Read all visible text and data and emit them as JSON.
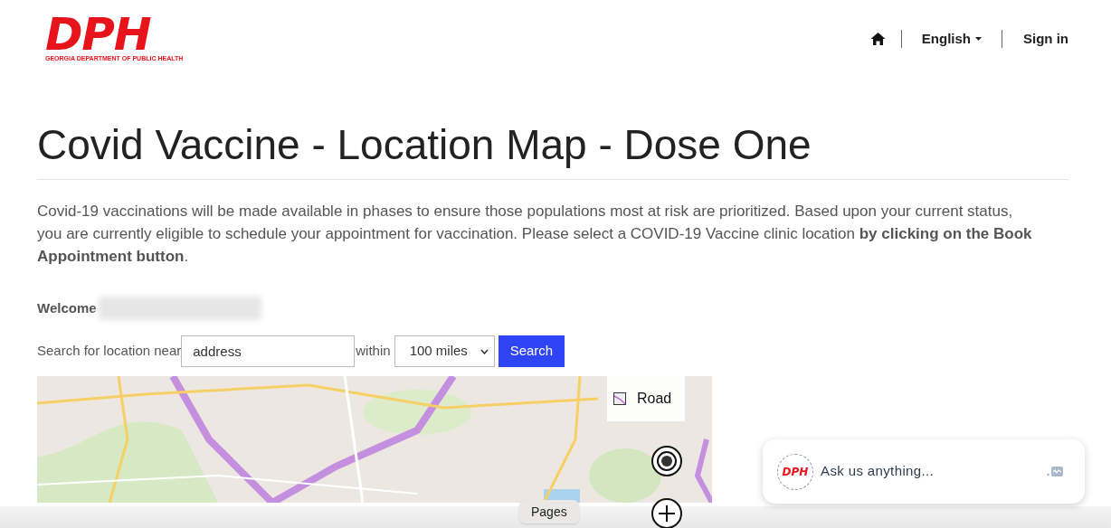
{
  "logo": {
    "letters": "DPH",
    "caption": "GEORGIA DEPARTMENT OF PUBLIC HEALTH"
  },
  "nav": {
    "language": "English",
    "sign_in": "Sign in"
  },
  "title": "Covid Vaccine - Location Map - Dose One",
  "intro": "Covid-19 vaccinations will be made available in phases to ensure those populations most at risk are prioritized. Based upon your current status, you are currently eligible to schedule your appointment for vaccination. Please select a COVID-19 Vaccine clinic location **by clicking on the Book Appointment button**.",
  "welcome": {
    "label": "Welcome",
    "name_redacted": true
  },
  "search": {
    "label": "Search for location near",
    "value": "address",
    "within_label": "within",
    "radius": "100 miles",
    "button": "Search"
  },
  "map": {
    "kind": "picture",
    "layer_button": "Road"
  },
  "tooltip": "Pages",
  "chat": {
    "logo_letters": "DPH",
    "placeholder": "Ask us anything..."
  }
}
